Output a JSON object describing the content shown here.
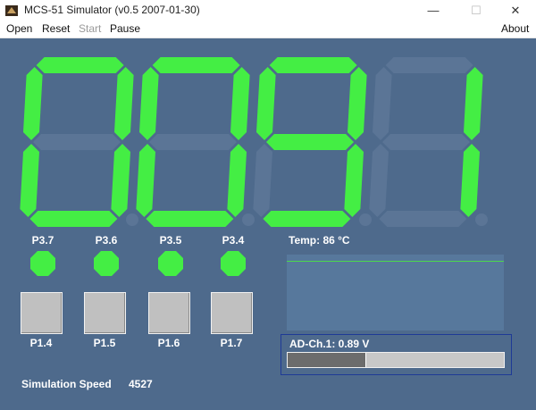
{
  "window": {
    "title": "MCS-51 Simulator (v0.5 2007-01-30)",
    "minimize_glyph": "—",
    "maximize_glyph": "☐",
    "close_glyph": "✕"
  },
  "menu": {
    "open": "Open",
    "reset": "Reset",
    "start": "Start",
    "pause": "Pause",
    "about": "About"
  },
  "display": {
    "on_color": "#44ee44",
    "off_color": "#5b7596",
    "digits": [
      {
        "value": "0",
        "dp": false
      },
      {
        "value": "0",
        "dp": false
      },
      {
        "value": "9",
        "dp": false
      },
      {
        "value": "1",
        "dp": false
      }
    ]
  },
  "leds": [
    {
      "label": "P3.7",
      "on": true
    },
    {
      "label": "P3.6",
      "on": true
    },
    {
      "label": "P3.5",
      "on": true
    },
    {
      "label": "P3.4",
      "on": true
    }
  ],
  "led_color": "#44ee44",
  "switches": [
    {
      "label": "P1.4"
    },
    {
      "label": "P1.5"
    },
    {
      "label": "P1.6"
    },
    {
      "label": "P1.7"
    }
  ],
  "temperature": {
    "label": "Temp:  86 °C",
    "line_color": "#4cd94c"
  },
  "ad": {
    "label": "AD-Ch.1: 0.89 V",
    "level_fraction": 0.36
  },
  "simulation": {
    "label": "Simulation Speed",
    "value": "4527"
  }
}
